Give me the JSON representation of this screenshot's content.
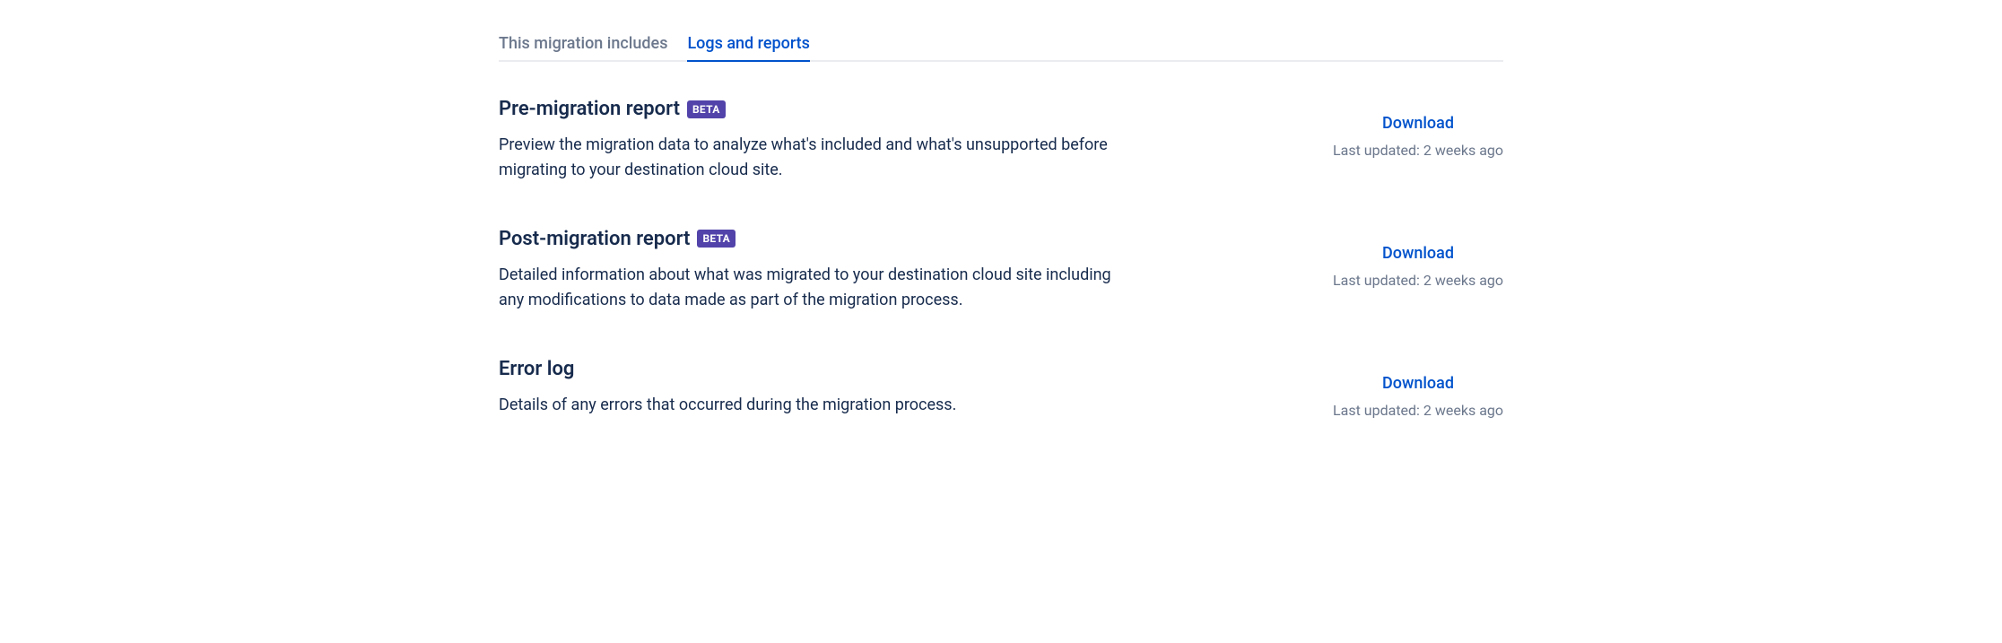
{
  "tabs": {
    "migration_includes": "This migration includes",
    "logs_reports": "Logs and reports"
  },
  "reports": {
    "pre_migration": {
      "title": "Pre-migration report",
      "badge": "BETA",
      "description": "Preview the migration data to analyze what's included and what's unsupported before migrating to your destination cloud site.",
      "download_label": "Download",
      "last_updated": "Last updated: 2 weeks ago"
    },
    "post_migration": {
      "title": "Post-migration report",
      "badge": "BETA",
      "description": "Detailed information about what was migrated to your destination cloud site including any modifications to data made as part of the migration process.",
      "download_label": "Download",
      "last_updated": "Last updated: 2 weeks ago"
    },
    "error_log": {
      "title": "Error log",
      "description": "Details of any errors that occurred during the migration process.",
      "download_label": "Download",
      "last_updated": "Last updated: 2 weeks ago"
    }
  }
}
